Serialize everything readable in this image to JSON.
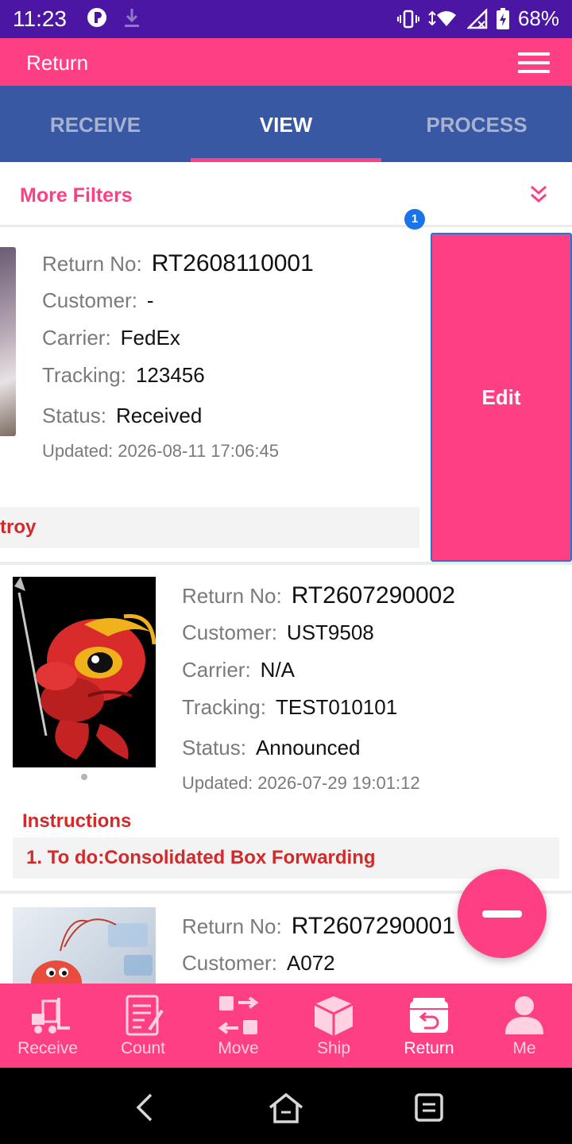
{
  "status_bar": {
    "time": "11:23",
    "battery": "68%",
    "icons": [
      "app-notification-icon",
      "download-icon",
      "vibrate-icon",
      "wifi-icon",
      "signal-icon",
      "battery-charging-icon"
    ]
  },
  "app_bar": {
    "title": "Return",
    "menu_icon": "hamburger-menu-icon"
  },
  "tabs": [
    {
      "label": "RECEIVE",
      "active": false
    },
    {
      "label": "VIEW",
      "active": true
    },
    {
      "label": "PROCESS",
      "active": false
    }
  ],
  "filters": {
    "label": "More Filters",
    "icon": "double-chevron-down-icon",
    "badge": "1"
  },
  "returns": [
    {
      "return_no_label": "Return No:",
      "return_no": "RT2608110001",
      "customer_label": "Customer:",
      "customer": "-",
      "carrier_label": "Carrier:",
      "carrier": "FedEx",
      "tracking_label": "Tracking:",
      "tracking": "123456",
      "status_label": "Status:",
      "status": "Received",
      "updated_label": "Updated:",
      "updated": "2026-08-11 17:06:45",
      "instruction": "troy",
      "action": "Edit"
    },
    {
      "return_no_label": "Return No:",
      "return_no": "RT2607290002",
      "customer_label": "Customer:",
      "customer": "UST9508",
      "carrier_label": "Carrier:",
      "carrier": "N/A",
      "tracking_label": "Tracking:",
      "tracking": "TEST010101",
      "status_label": "Status:",
      "status": "Announced",
      "updated_label": "Updated:",
      "updated": "2026-07-29 19:01:12",
      "instructions_title": "Instructions",
      "instruction": "1. To do:Consolidated Box Forwarding"
    },
    {
      "return_no_label": "Return No:",
      "return_no": "RT2607290001",
      "customer_label": "Customer:",
      "customer": "A072"
    }
  ],
  "fab_icon": "minus-icon",
  "bottom_nav": [
    {
      "label": "Receive",
      "icon": "forklift-icon",
      "active": false
    },
    {
      "label": "Count",
      "icon": "clipboard-icon",
      "active": false
    },
    {
      "label": "Move",
      "icon": "move-arrows-icon",
      "active": false
    },
    {
      "label": "Ship",
      "icon": "box-icon",
      "active": false
    },
    {
      "label": "Return",
      "icon": "return-box-icon",
      "active": true
    },
    {
      "label": "Me",
      "icon": "person-icon",
      "active": false
    }
  ],
  "system_nav": [
    "back-icon",
    "home-icon",
    "recents-icon"
  ],
  "colors": {
    "primary": "#ff3f84",
    "tab_bar": "#3858a3",
    "status_bar": "#4b16a3",
    "instruction_text": "#d22a2a"
  }
}
